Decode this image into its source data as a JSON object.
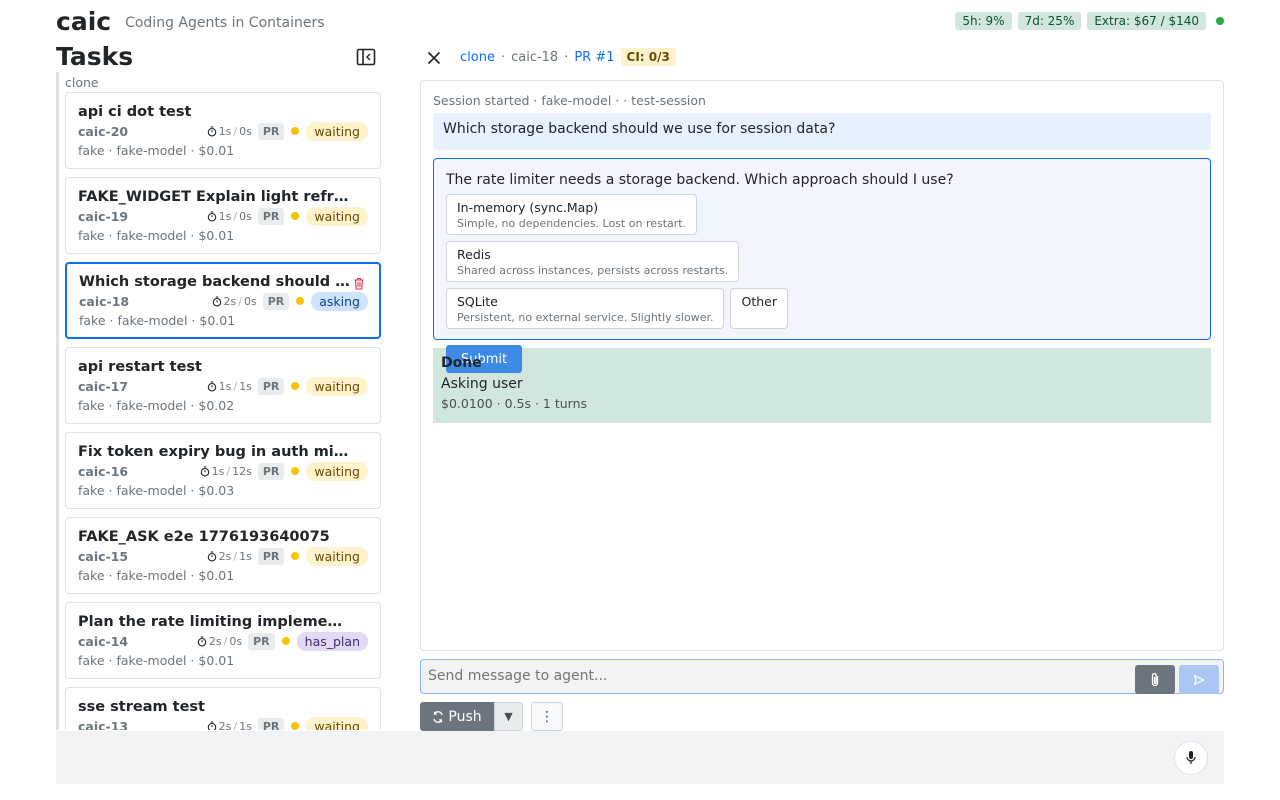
{
  "header": {
    "brand": "caic",
    "tagline": "Coding Agents in Containers",
    "usage": [
      "5h: 9%",
      "7d: 25%",
      "Extra: $67 / $140"
    ]
  },
  "tasks_panel": {
    "title": "Tasks",
    "group_label": "clone",
    "items": [
      {
        "title": "api ci dot test",
        "id": "caic-20",
        "t1": "1s",
        "t2": "0s",
        "pr": "PR",
        "status": "waiting",
        "sub": "fake · fake-model · $0.01"
      },
      {
        "title": "FAKE_WIDGET Explain light refr…",
        "id": "caic-19",
        "t1": "1s",
        "t2": "0s",
        "pr": "PR",
        "status": "waiting",
        "sub": "fake · fake-model · $0.01"
      },
      {
        "title": "Which storage backend should …",
        "id": "caic-18",
        "t1": "2s",
        "t2": "0s",
        "pr": "PR",
        "status": "asking",
        "sub": "fake · fake-model · $0.01"
      },
      {
        "title": "api restart test",
        "id": "caic-17",
        "t1": "1s",
        "t2": "1s",
        "pr": "PR",
        "status": "waiting",
        "sub": "fake · fake-model · $0.02"
      },
      {
        "title": "Fix token expiry bug in auth mi…",
        "id": "caic-16",
        "t1": "1s",
        "t2": "12s",
        "pr": "PR",
        "status": "waiting",
        "sub": "fake · fake-model · $0.03"
      },
      {
        "title": "FAKE_ASK e2e 1776193640075",
        "id": "caic-15",
        "t1": "2s",
        "t2": "1s",
        "pr": "PR",
        "status": "waiting",
        "sub": "fake · fake-model · $0.01"
      },
      {
        "title": "Plan the rate limiting implemen…",
        "id": "caic-14",
        "t1": "2s",
        "t2": "0s",
        "pr": "PR",
        "status": "has_plan",
        "sub": "fake · fake-model · $0.01"
      },
      {
        "title": "sse stream test",
        "id": "caic-13",
        "t1": "2s",
        "t2": "1s",
        "pr": "PR",
        "status": "waiting",
        "sub": ""
      }
    ]
  },
  "detail": {
    "crumb_repo": "clone",
    "crumb_task": "caic-18",
    "crumb_pr": "PR #1",
    "ci": "CI: 0/3",
    "session_meta": "Session started · fake-model · · test-session",
    "user_message": "Which storage backend should we use for session data?",
    "ask": {
      "question": "The rate limiter needs a storage backend. Which approach should I use?",
      "options": [
        {
          "label": "In-memory (sync.Map)",
          "desc": "Simple, no dependencies. Lost on restart."
        },
        {
          "label": "Redis",
          "desc": "Shared across instances, persists across restarts."
        },
        {
          "label": "SQLite",
          "desc": "Persistent, no external service. Slightly slower."
        },
        {
          "label": "Other",
          "desc": ""
        }
      ],
      "submit": "Submit"
    },
    "done": {
      "title": "Done",
      "text": "Asking user",
      "meta": "$0.0100 · 0.5s · 1 turns"
    }
  },
  "composer": {
    "placeholder": "Send message to agent..."
  },
  "actions": {
    "push": "Push",
    "dropdown": "▼",
    "more": "⋮"
  },
  "colors": {
    "accent": "#0d6efd",
    "waiting": "#fff3cd",
    "asking": "#cfe2ff",
    "has_plan": "#e2d9f3",
    "done": "#d1e7dd"
  }
}
